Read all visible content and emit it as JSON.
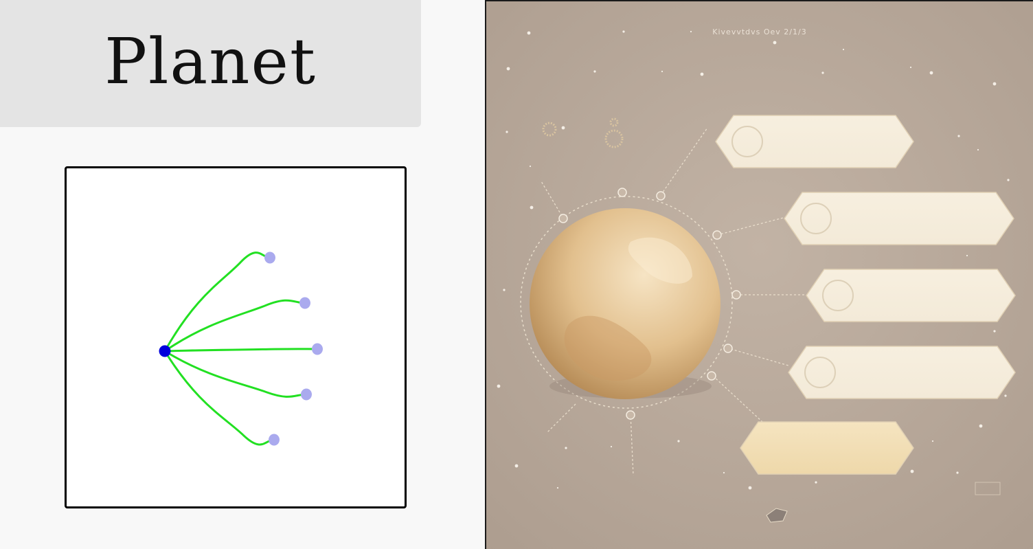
{
  "title": "Planet",
  "diagram": {
    "hub_color": "#0000dd",
    "edge_color": "#22e022",
    "leaf_color": "#aaaaee",
    "leaf_count": 5
  },
  "art": {
    "background_color": "#b8a89a",
    "planet_color": "#e2c08e",
    "label_color": "#f3ead8",
    "caption": "Kivevvtdvs Oev 2/1/3",
    "label_panel_count": 5
  }
}
